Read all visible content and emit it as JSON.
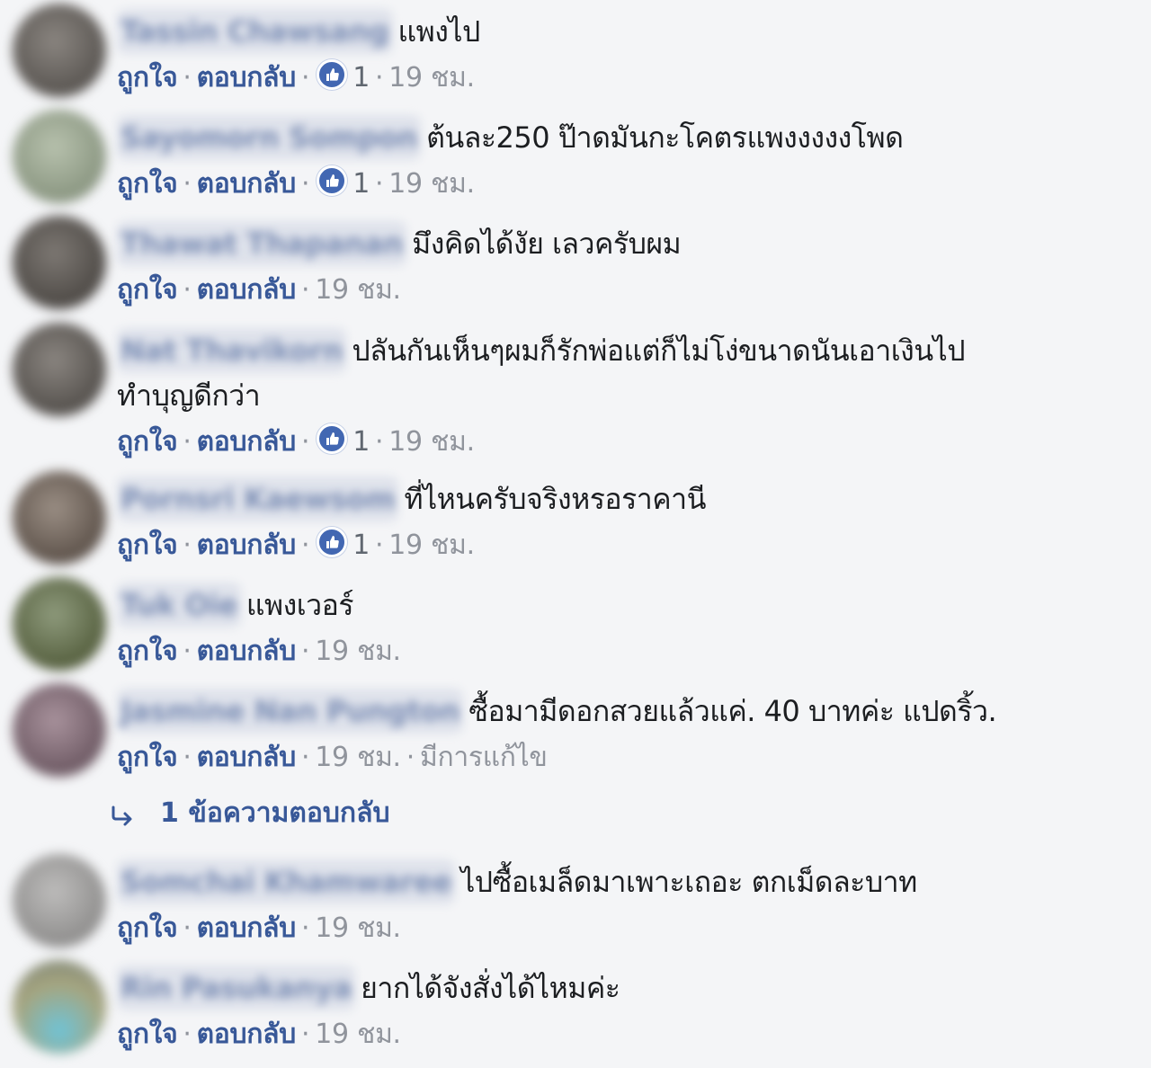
{
  "actions": {
    "like": "ถูกใจ",
    "reply": "ตอบกลับ",
    "separator": "·",
    "edited": "มีการแก้ไข"
  },
  "comments": [
    {
      "name": "Tassin Chawsang",
      "text": "แพงไป",
      "likes": "1",
      "time": "19 ชม.",
      "avatar_color": "#6e6b68"
    },
    {
      "name": "Sayomorn Sompon",
      "text": "ต้นละ250 ป๊าดมันกะโคตรแพงงงงงโพด",
      "likes": "1",
      "time": "19 ชม.",
      "avatar_color": "#9aa592"
    },
    {
      "name": "Thawat Thapanan",
      "text": "มึงคิดได้งัย เลวครับผม",
      "likes": "",
      "time": "19 ชม.",
      "avatar_color": "#6a655f"
    },
    {
      "name": "Nat Thavikorn",
      "text": "ปลันกันเห็นๆผมก็รักพ่อแต่ก็ไม่โง่ขนาดนันเอาเงินไป",
      "text_cont": "ทำบุญดีกว่า",
      "likes": "1",
      "time": "19 ชม.",
      "avatar_color": "#75716c"
    },
    {
      "name": "Pornsri Kaewsom",
      "text": "ที่ไหนครับจริงหรอราคานี",
      "likes": "1",
      "time": "19 ชม.",
      "avatar_color": "#7a6f66"
    },
    {
      "name": "Tuk Oie",
      "text": "แพงเวอร์",
      "likes": "",
      "time": "19 ชม.",
      "avatar_color": "#6f7a5e"
    },
    {
      "name": "Jasmine Nan Pungton",
      "text": "ซื้อมามีดอกสวยแล้วแค่. 40 บาทค่ะ แปดริ้ว.",
      "likes": "",
      "time": "19 ชม.",
      "edited": true,
      "avatar_color": "#8b7882"
    },
    {
      "name": "Somchai Khamwaree",
      "text": "ไปซื้อเมล็ดมาเพาะเถอะ ตกเม็ดละบาท",
      "likes": "",
      "time": "19 ชม.",
      "avatar_color": "#a9a8a7"
    },
    {
      "name": "Rin Pasukanya",
      "text": "ยากได้จังสั่งได้ไหมค่ะ",
      "likes": "",
      "time": "19 ชม.",
      "avatar_color": "#7fb3b8"
    }
  ],
  "replies_link": "1 ข้อความตอบกลับ",
  "colors": {
    "link": "#385898",
    "like_badge": "#4267b2",
    "meta_grey": "#90949c",
    "background": "#f4f5f7"
  }
}
